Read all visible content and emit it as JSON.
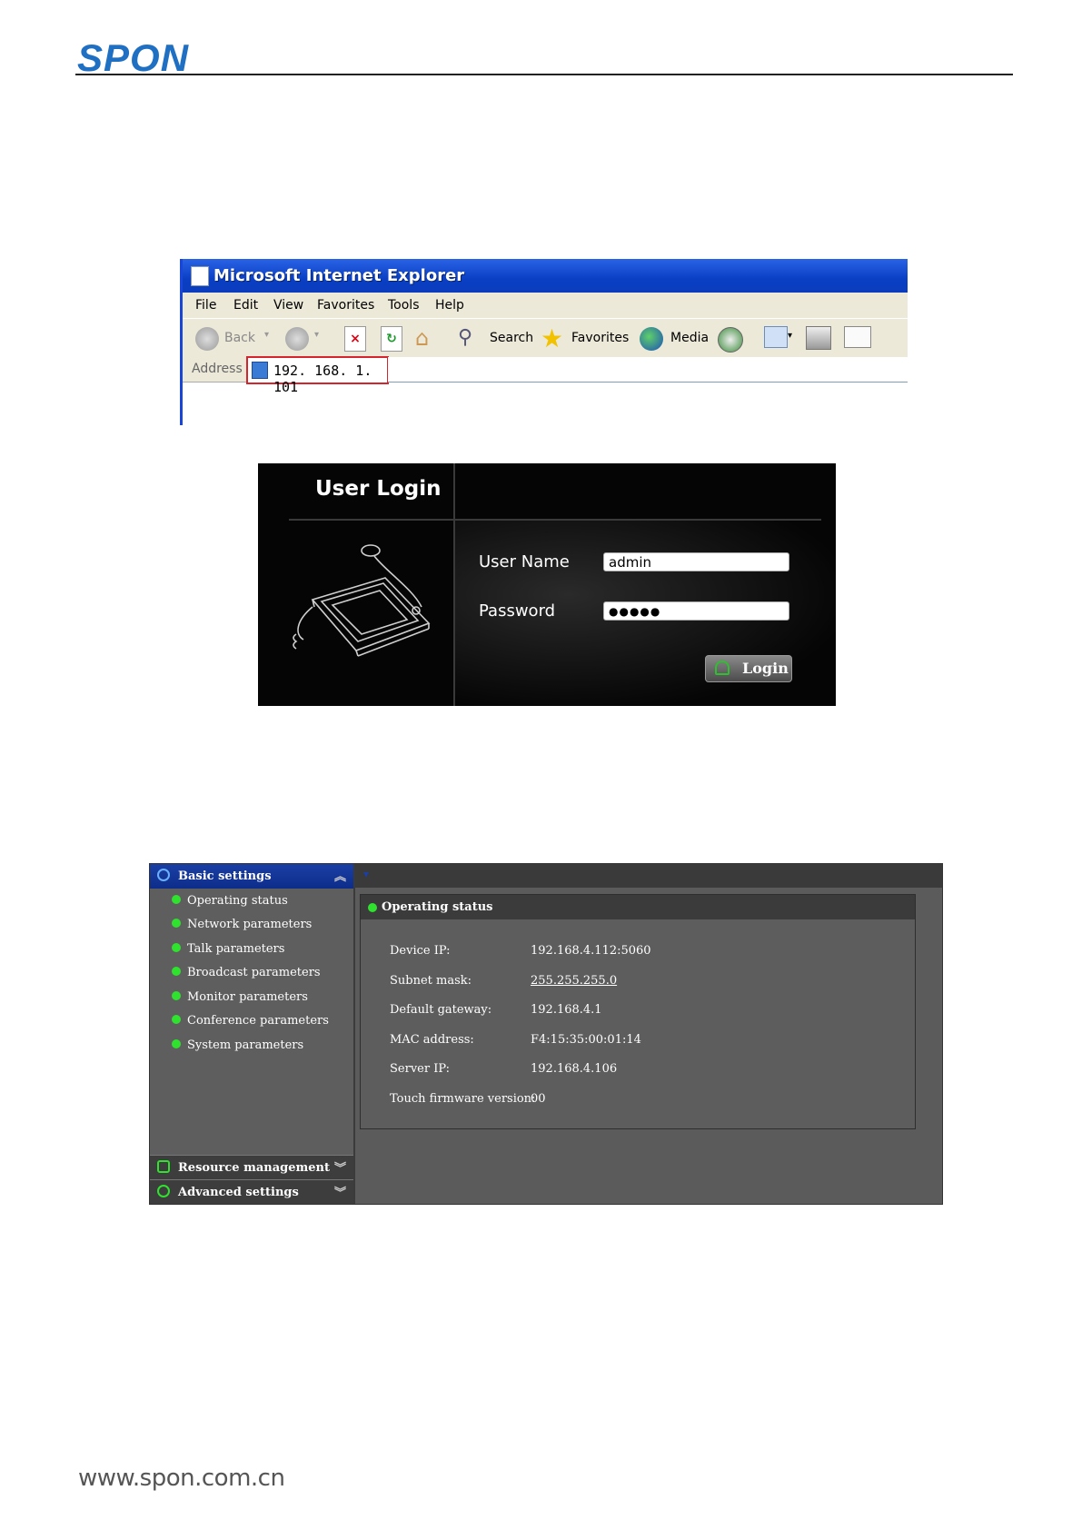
{
  "header": {
    "logo": "SPON"
  },
  "footer": {
    "url": "www.spon.com.cn"
  },
  "browser": {
    "title": "Microsoft Internet Explorer",
    "menu": [
      "File",
      "Edit",
      "View",
      "Favorites",
      "Tools",
      "Help"
    ],
    "toolbar": {
      "back": "Back",
      "search": "Search",
      "favorites": "Favorites",
      "media": "Media"
    },
    "address_label": "Address",
    "address_value": "192. 168. 1. 101"
  },
  "login": {
    "title": "User Login",
    "username_label": "User Name",
    "username_value": "admin",
    "password_label": "Password",
    "password_value": "●●●●●",
    "button": "Login"
  },
  "settings": {
    "sidebar_title": "Basic settings",
    "sidebar_items": [
      "Operating status",
      "Network parameters",
      "Talk parameters",
      "Broadcast parameters",
      "Monitor parameters",
      "Conference parameters",
      "System parameters"
    ],
    "resource_management": "Resource management",
    "advanced_settings": "Advanced settings",
    "status_title": "Operating status",
    "rows": [
      {
        "label": "Device IP:",
        "value": "192.168.4.112:5060"
      },
      {
        "label": "Subnet mask:",
        "value": "255.255.255.0"
      },
      {
        "label": "Default gateway:",
        "value": "192.168.4.1"
      },
      {
        "label": "MAC address:",
        "value": "F4:15:35:00:01:14"
      },
      {
        "label": "Server IP:",
        "value": "192.168.4.106"
      },
      {
        "label": "Touch firmware version:",
        "value": "00"
      }
    ]
  }
}
